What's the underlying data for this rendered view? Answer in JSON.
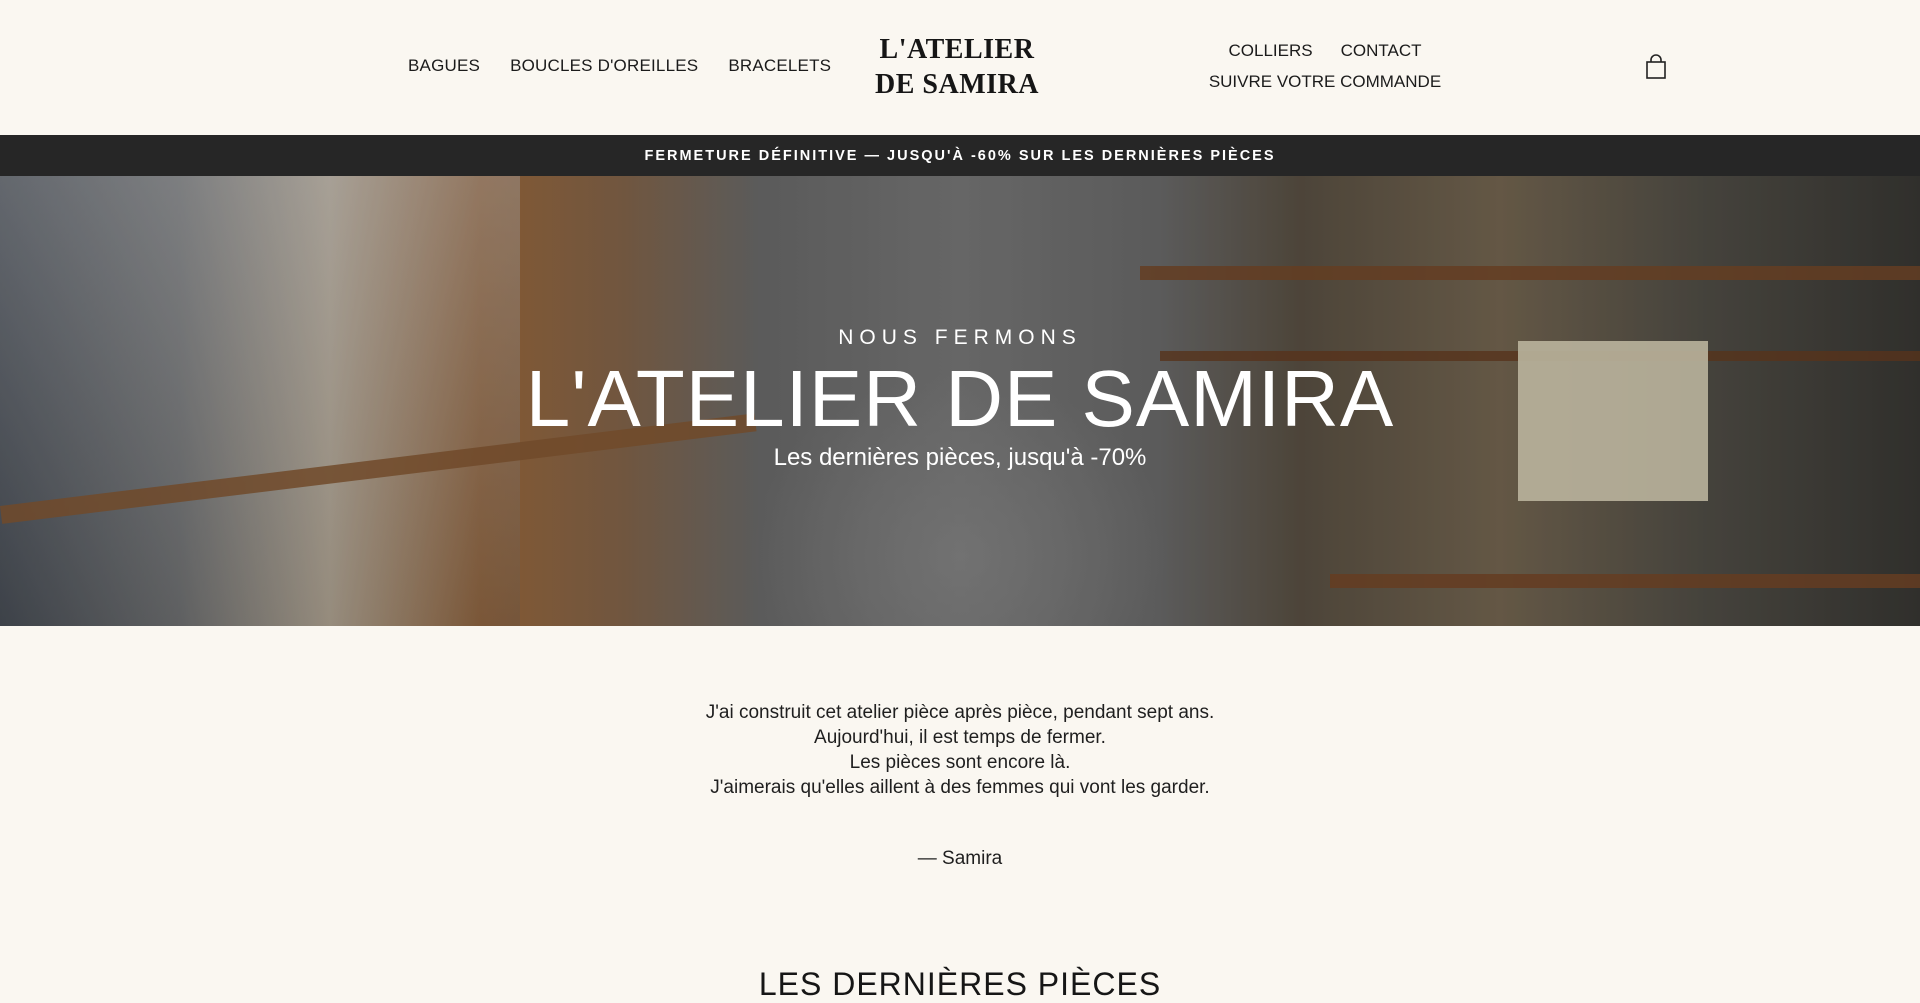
{
  "header": {
    "nav_left": [
      "BAGUES",
      "BOUCLES D'OREILLES",
      "BRACELETS"
    ],
    "logo_line1": "L'ATELIER",
    "logo_line2": "DE SAMIRA",
    "nav_right_row1": [
      "COLLIERS",
      "CONTACT"
    ],
    "nav_right_row2": "SUIVRE VOTRE COMMANDE",
    "cart_icon": "shopping-bag-icon"
  },
  "announcement": {
    "text": "FERMETURE DÉFINITIVE — JUSQU'À -60% SUR LES DERNIÈRES PIÈCES"
  },
  "hero": {
    "eyebrow": "NOUS FERMONS",
    "title": "L'ATELIER DE SAMIRA",
    "subtitle": "Les dernières pièces, jusqu'à -70%"
  },
  "letter": {
    "lines": [
      "J'ai construit cet atelier pièce après pièce, pendant sept ans.",
      "Aujourd'hui, il est temps de fermer.",
      "Les pièces sont encore là.",
      "J'aimerais qu'elles aillent à des femmes qui vont les garder."
    ],
    "signature": "— Samira"
  },
  "section": {
    "title": "LES DERNIÈRES PIÈCES"
  },
  "colors": {
    "background": "#faf7f1",
    "announce_bg": "#262626",
    "text": "#1f1f1f"
  }
}
